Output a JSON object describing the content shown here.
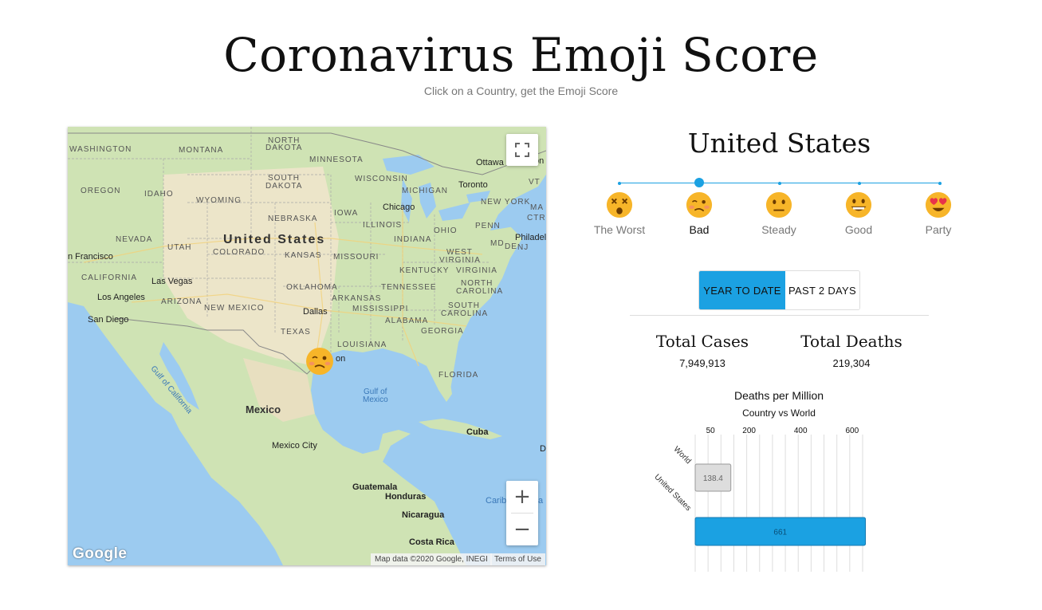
{
  "header": {
    "title": "Coronavirus Emoji Score",
    "subtitle": "Click on a Country, get the Emoji Score"
  },
  "map": {
    "labels": {
      "washington": "WASHINGTON",
      "montana": "MONTANA",
      "north_dakota_1": "NORTH",
      "north_dakota_2": "DAKOTA",
      "minnesota": "MINNESOTA",
      "ottawa": "Ottawa",
      "south_dakota_1": "SOUTH",
      "south_dakota_2": "DAKOTA",
      "wisconsin": "WISCONSIN",
      "michigan": "MICHIGAN",
      "toronto": "Toronto",
      "vt": "VT",
      "oregon": "OREGON",
      "idaho": "IDAHO",
      "wyoming": "WYOMING",
      "nebraska": "NEBRASKA",
      "iowa": "IOWA",
      "chicago": "Chicago",
      "new_york": "NEW YORK",
      "ma": "MA",
      "ctr": "CTR",
      "illinois": "ILLINOIS",
      "ohio": "OHIO",
      "penn": "PENN",
      "nevada": "NEVADA",
      "united_states": "United States",
      "indiana": "INDIANA",
      "md": "MD",
      "philadel": "Philadel",
      "utah": "UTAH",
      "colorado": "COLORADO",
      "de": "DE",
      "nj": "NJ",
      "san_francisco": "n Francisco",
      "kansas": "KANSAS",
      "missouri": "MISSOURI",
      "west_1": "WEST",
      "west_2": "VIRGINIA",
      "virginia": "VIRGINIA",
      "california": "CALIFORNIA",
      "las_vegas": "Las Vegas",
      "kentucky": "KENTUCKY",
      "oklahoma": "OKLAHOMA",
      "tennessee": "TENNESSEE",
      "nc_1": "NORTH",
      "nc_2": "CAROLINA",
      "los_angeles": "Los Angeles",
      "arizona": "ARIZONA",
      "new_mexico": "NEW MEXICO",
      "arkansas": "ARKANSAS",
      "mississippi": "MISSISSIPPI",
      "sc_1": "SOUTH",
      "sc_2": "CAROLINA",
      "dallas": "Dallas",
      "san_diego": "San Diego",
      "alabama": "ALABAMA",
      "texas": "TEXAS",
      "georgia": "GEORGIA",
      "louisiana": "LOUISIANA",
      "houston_fragment": "on",
      "gulf_ca": "Gulf of California",
      "florida": "FLORIDA",
      "gulf_mexico_1": "Gulf of",
      "gulf_mexico_2": "Mexico",
      "mexico": "Mexico",
      "cuba": "Cuba",
      "mexico_city": "Mexico City",
      "d_fragment": "D",
      "guatemala": "Guatemala",
      "honduras": "Honduras",
      "caribbean": "Carib",
      "caribbean_2": "a",
      "nicaragua": "Nicaragua",
      "costa_rica": "Costa Rica",
      "on_fragment": "on"
    },
    "google_logo": "Google",
    "attribution": "Map data ©2020 Google, INEGI",
    "terms": "Terms of Use",
    "zoom_in": "+",
    "zoom_out": "−",
    "marker_icon": "woozy-face-emoji"
  },
  "panel": {
    "country": "United States",
    "scale": {
      "selected_index": 1,
      "levels": [
        {
          "label": "The Worst",
          "icon": "dizzy-face-emoji"
        },
        {
          "label": "Bad",
          "icon": "woozy-face-emoji"
        },
        {
          "label": "Steady",
          "icon": "neutral-face-emoji"
        },
        {
          "label": "Good",
          "icon": "grinning-face-emoji"
        },
        {
          "label": "Party",
          "icon": "heart-eyes-emoji"
        }
      ]
    },
    "toggle": {
      "year_to_date": "YEAR TO DATE",
      "past_2_days": "PAST 2 DAYS",
      "active": "year_to_date"
    },
    "stats": {
      "total_cases_label": "Total Cases",
      "total_cases_value": "7,949,913",
      "total_deaths_label": "Total Deaths",
      "total_deaths_value": "219,304"
    }
  },
  "chart_data": {
    "type": "bar",
    "orientation": "horizontal",
    "title": "Deaths per Million",
    "subtitle": "Country vs World",
    "categories": [
      "World",
      "United States"
    ],
    "values": [
      138.4,
      661
    ],
    "data_labels": [
      "138.4",
      "661"
    ],
    "x_ticks": [
      "50",
      "200",
      "400",
      "600"
    ],
    "xlim": [
      0,
      650
    ],
    "grid": true,
    "colors": [
      "#dddddd",
      "#1ba1e2"
    ]
  }
}
